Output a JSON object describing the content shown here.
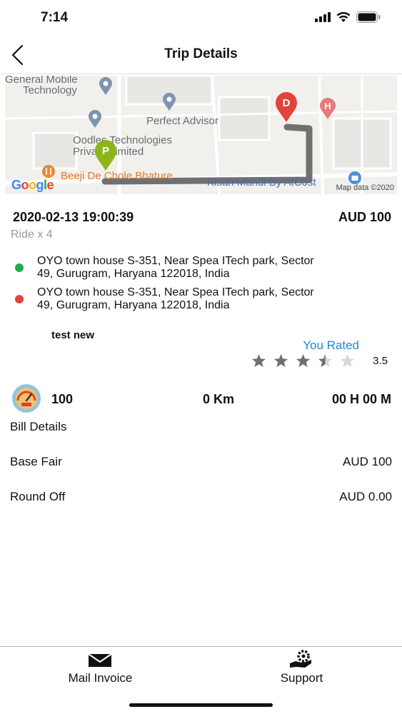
{
  "status_bar": {
    "time": "7:14"
  },
  "header": {
    "title": "Trip Details"
  },
  "map": {
    "labels": [
      "General Mobile",
      "Technology",
      "Perfect Advisor",
      "Oodles Technologies",
      "Private Limited",
      "Beeji De Chole Bhature",
      "Kisan Mandi By AtCost"
    ],
    "pickup_marker": "P",
    "drop_marker": "D",
    "hospital_marker": "H",
    "logo": "Google",
    "attribution": "Map data ©2020"
  },
  "trip": {
    "datetime": "2020-02-13 19:00:39",
    "fare": "AUD 100",
    "ride_type": "Ride x 4",
    "pickup_line1": "OYO town house S-351, Near Spea ITech park, Sector",
    "pickup_line2": "49, Gurugram, Haryana 122018, India",
    "drop_line1": "OYO town house S-351, Near Spea ITech park, Sector",
    "drop_line2": "49, Gurugram, Haryana 122018, India",
    "comment": "test new",
    "rated_label": "You Rated",
    "rating": 3.5,
    "rating_text": "3.5"
  },
  "stats": {
    "value": "100",
    "distance": "0 Km",
    "duration": "00 H 00 M"
  },
  "bill": {
    "title": "Bill Details",
    "base_label": "Base Fair",
    "base_value": "AUD 100",
    "round_label": "Round Off",
    "round_value": "AUD 0.00"
  },
  "bottom": {
    "mail_label": "Mail Invoice",
    "support_label": "Support"
  },
  "colors": {
    "pickup": "#1fae4b",
    "drop": "#e0443a",
    "accent": "#1e88d3",
    "route": "#707070"
  }
}
